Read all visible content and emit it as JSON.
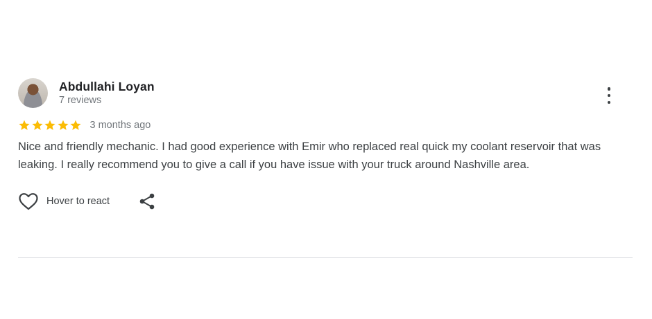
{
  "review": {
    "author_name": "Abdullahi Loyan",
    "author_reviews": "7 reviews",
    "rating": 5,
    "rating_max": 5,
    "date": "3 months ago",
    "text": "Nice and friendly mechanic. I had good experience with Emir who replaced real quick my coolant reservoir that was leaking. I really recommend you to give a call if you have issue with your truck around Nashville area.",
    "react_label": "Hover to react",
    "star_color": "#fbbc04"
  },
  "icons": {
    "menu": "more-vert-icon",
    "like": "heart-icon",
    "share": "share-icon"
  }
}
